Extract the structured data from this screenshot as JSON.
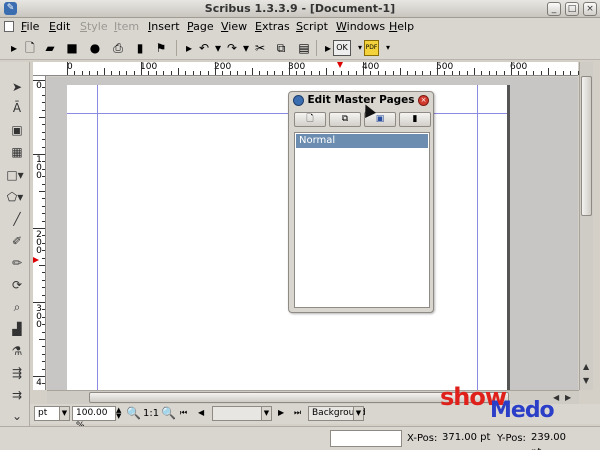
{
  "window": {
    "title": "Scribus 1.3.3.9 - [Document-1]",
    "controls": [
      "minimize",
      "maximize",
      "close"
    ]
  },
  "menu": {
    "items": [
      {
        "label": "File",
        "enabled": true
      },
      {
        "label": "Edit",
        "enabled": true
      },
      {
        "label": "Style",
        "enabled": false
      },
      {
        "label": "Item",
        "enabled": false
      },
      {
        "label": "Insert",
        "enabled": true
      },
      {
        "label": "Page",
        "enabled": true
      },
      {
        "label": "View",
        "enabled": true
      },
      {
        "label": "Extras",
        "enabled": true
      },
      {
        "label": "Script",
        "enabled": true
      },
      {
        "label": "Windows",
        "enabled": true
      },
      {
        "label": "Help",
        "enabled": true
      }
    ]
  },
  "toolbar": {
    "preflight_label": "OK",
    "pdf_label": "PDF"
  },
  "ruler": {
    "h_marks": [
      "0",
      "100",
      "200",
      "300",
      "400",
      "500",
      "600"
    ],
    "v_marks": [
      "0",
      "100",
      "200",
      "300",
      "4"
    ]
  },
  "dialog": {
    "title": "Edit Master Pages",
    "list": [
      "Normal"
    ],
    "selected": "Normal"
  },
  "zoom": {
    "unit": "pt",
    "zoom_value": "100.00 %",
    "ratio_label": "1:1",
    "page_value": "",
    "layer": "Background"
  },
  "status": {
    "xpos_label": "X-Pos:",
    "xpos_value": "371.00 pt",
    "ypos_label": "Y-Pos:",
    "ypos_value": "239.00 pt"
  },
  "watermark": {
    "part1": "show",
    "part2": "Medo"
  },
  "colors": {
    "selection": "#6c8db0",
    "guide": "#8a8ae0",
    "watermark_red": "#e0201a",
    "watermark_blue": "#2a3ec8"
  }
}
